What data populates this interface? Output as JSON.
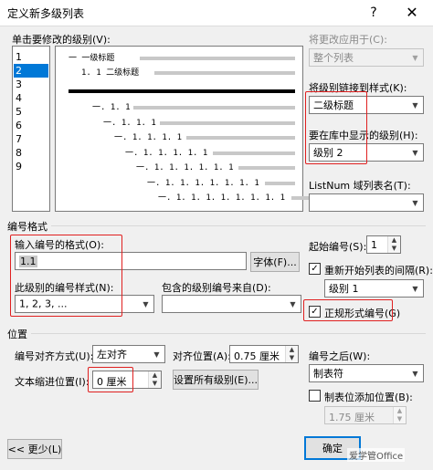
{
  "window": {
    "title": "定义新多级列表",
    "help": "?",
    "close": "✕"
  },
  "level_picker": {
    "label": "单击要修改的级别(V):",
    "levels": [
      "1",
      "2",
      "3",
      "4",
      "5",
      "6",
      "7",
      "8",
      "9"
    ],
    "selected": "2"
  },
  "preview": {
    "level1_text": "一 一级标题",
    "level2_text": "1. 1 二级标题",
    "rows": [
      "一. 1. 1",
      "一. 1. 1. 1",
      "一. 1. 1. 1. 1",
      "一. 1. 1. 1. 1. 1",
      "一. 1. 1. 1. 1. 1. 1",
      "一. 1. 1. 1. 1. 1. 1. 1",
      "一. 1. 1. 1. 1. 1. 1. 1. 1"
    ]
  },
  "apply_changes": {
    "label": "将更改应用于(C):",
    "value": "整个列表"
  },
  "link_style": {
    "label": "将级别链接到样式(K):",
    "value": "二级标题"
  },
  "gallery_level": {
    "label": "要在库中显示的级别(H):",
    "value": "级别 2"
  },
  "listnum": {
    "label": "ListNum 域列表名(T):",
    "value": ""
  },
  "number_format": {
    "section_label": "编号格式",
    "input_label": "输入编号的格式(O):",
    "input_value": "1.1",
    "font_button": "字体(F)...",
    "style_label": "此级别的编号样式(N):",
    "style_value": "1, 2, 3, ...",
    "include_label": "包含的级别编号来自(D):",
    "include_value": ""
  },
  "start_at": {
    "label": "起始编号(S):",
    "value": "1"
  },
  "restart": {
    "label": "重新开始列表的间隔(R):",
    "checked": true,
    "value": "级别 1"
  },
  "legal": {
    "label": "正规形式编号(G)",
    "checked": true
  },
  "position": {
    "section_label": "位置",
    "align_label": "编号对齐方式(U):",
    "align_value": "左对齐",
    "align_at_label": "对齐位置(A):",
    "align_at_value": "0.75 厘米",
    "follow_label": "编号之后(W):",
    "follow_value": "制表符",
    "indent_label": "文本缩进位置(I):",
    "indent_value": "0 厘米",
    "set_all_button": "设置所有级别(E)...",
    "tab_stop_label": "制表位添加位置(B):",
    "tab_stop_checked": false,
    "tab_stop_value": "1.75 厘米"
  },
  "footer": {
    "less_button": "<< 更少(L)",
    "ok_button": "确定",
    "watermark": "爱学管Office"
  },
  "colors": {
    "selection": "#0078d7",
    "highlight": "#e02020"
  }
}
